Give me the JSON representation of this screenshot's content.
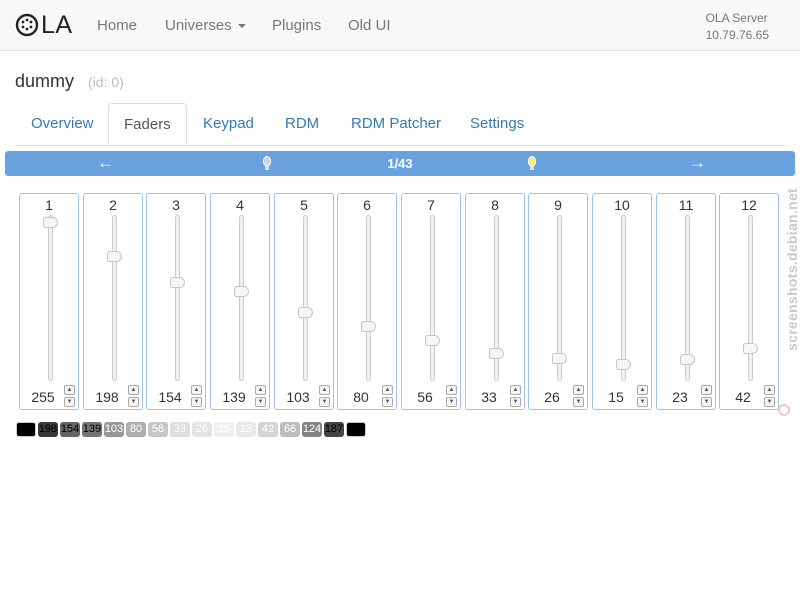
{
  "navbar": {
    "logo_text": "LA",
    "links": [
      "Home",
      "Universes",
      "Plugins",
      "Old UI"
    ],
    "server_label": "OLA Server",
    "server_ip": "10.79.76.65"
  },
  "universe": {
    "name": "dummy",
    "id_label": "(id: 0)"
  },
  "tabs": [
    "Overview",
    "Faders",
    "Keypad",
    "RDM",
    "RDM Patcher",
    "Settings"
  ],
  "active_tab": "Faders",
  "pager": {
    "page": "1/43",
    "prev_icon": "arrow-left-icon",
    "next_icon": "arrow-right-icon"
  },
  "faders": [
    {
      "channel": "1",
      "value": "255"
    },
    {
      "channel": "2",
      "value": "198"
    },
    {
      "channel": "3",
      "value": "154"
    },
    {
      "channel": "4",
      "value": "139"
    },
    {
      "channel": "5",
      "value": "103"
    },
    {
      "channel": "6",
      "value": "80"
    },
    {
      "channel": "7",
      "value": "56"
    },
    {
      "channel": "8",
      "value": "33"
    },
    {
      "channel": "9",
      "value": "26"
    },
    {
      "channel": "10",
      "value": "15"
    },
    {
      "channel": "11",
      "value": "23"
    },
    {
      "channel": "12",
      "value": "42"
    }
  ],
  "dmx_values": [
    255,
    198,
    154,
    139,
    103,
    80,
    56,
    33,
    26,
    15,
    23,
    42,
    66,
    124,
    187,
    255
  ],
  "dmx_default": 0,
  "watermark": "screenshots.debian.net",
  "colors": {
    "accent": "#337ab7",
    "pagebar": "#6aa2df",
    "cell_off": "#000000"
  }
}
